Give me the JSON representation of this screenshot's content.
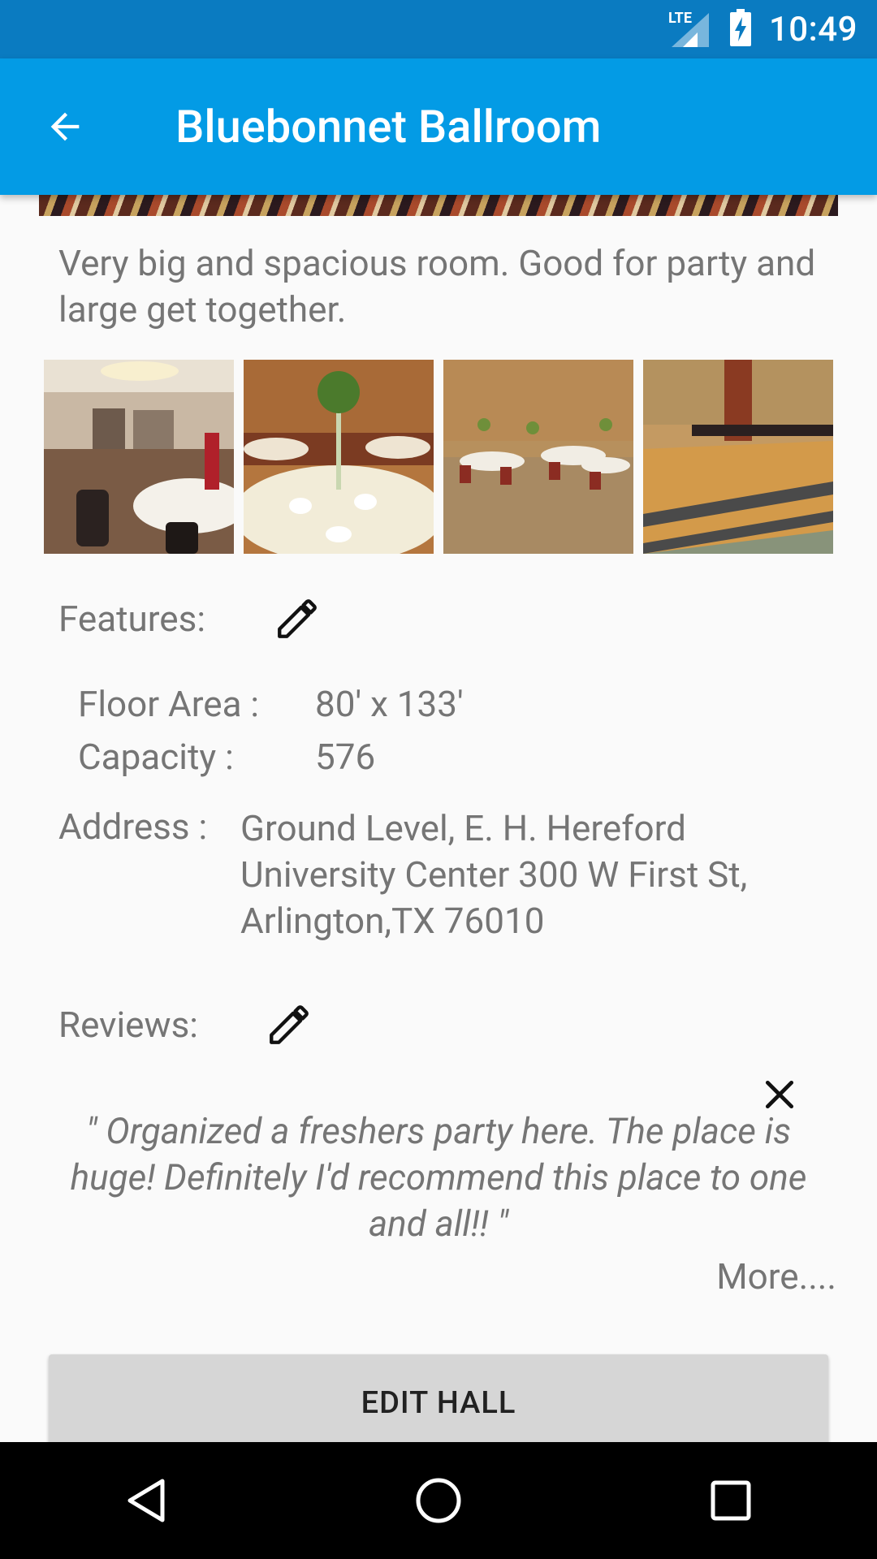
{
  "status_bar": {
    "network_label": "LTE",
    "time": "10:49",
    "icons": [
      "lte-signal-icon",
      "battery-charging-icon"
    ]
  },
  "app_bar": {
    "title": "Bluebonnet Ballroom",
    "back_icon": "arrow-back-icon",
    "background": "#039be5",
    "status_background": "#0a7bc1"
  },
  "description": "Very big and spacious room. Good for party and large get together.",
  "gallery": {
    "images": [
      {
        "name": "ballroom-photo-1"
      },
      {
        "name": "ballroom-photo-2"
      },
      {
        "name": "ballroom-photo-3"
      },
      {
        "name": "ballroom-photo-4"
      }
    ]
  },
  "features": {
    "label": "Features:",
    "edit_icon": "pencil-icon",
    "floor_area_label": "Floor Area :",
    "floor_area_value": "80' x 133'",
    "capacity_label": "Capacity :",
    "capacity_value": "576"
  },
  "address": {
    "label": "Address :",
    "value": "Ground Level, E. H. Hereford University Center 300 W First St, Arlington,TX 76010"
  },
  "reviews": {
    "label": "Reviews:",
    "edit_icon": "pencil-icon",
    "close_icon": "close-icon",
    "text": "\" Organized a freshers party here. The place is huge! Definitely I'd recommend this place to one and all!!  \"",
    "more_label": "More...."
  },
  "edit_button": {
    "label": "EDIT HALL"
  },
  "nav_bar": {
    "icons": [
      "back-triangle-icon",
      "home-circle-icon",
      "recents-square-icon"
    ]
  }
}
